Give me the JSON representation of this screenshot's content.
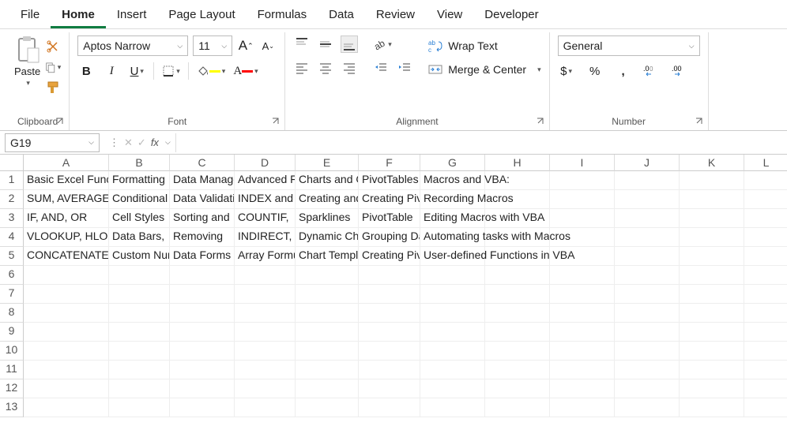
{
  "tabs": [
    "File",
    "Home",
    "Insert",
    "Page Layout",
    "Formulas",
    "Data",
    "Review",
    "View",
    "Developer"
  ],
  "active_tab": "Home",
  "ribbon": {
    "clipboard": {
      "label": "Clipboard",
      "paste": "Paste"
    },
    "font": {
      "label": "Font",
      "name": "Aptos Narrow",
      "size": "11",
      "increase": "A",
      "decrease": "A",
      "bold": "B",
      "italic": "I",
      "underline": "U"
    },
    "alignment": {
      "label": "Alignment",
      "wrap": "Wrap Text",
      "merge": "Merge & Center"
    },
    "number": {
      "label": "Number",
      "format": "General",
      "currency": "$",
      "percent": "%",
      "comma": ","
    }
  },
  "name_box": "G19",
  "formula": "",
  "columns": [
    "A",
    "B",
    "C",
    "D",
    "E",
    "F",
    "G",
    "H",
    "I",
    "J",
    "K",
    "L"
  ],
  "rows": [
    "1",
    "2",
    "3",
    "4",
    "5",
    "6",
    "7",
    "8",
    "9",
    "10",
    "11",
    "12",
    "13"
  ],
  "cells": {
    "r1": [
      "Basic Excel Functions",
      "Formatting",
      "Data Management",
      "Advanced Functions",
      "Charts and Graphs",
      "PivotTables",
      "Macros and VBA:",
      "",
      "",
      "",
      "",
      ""
    ],
    "r2": [
      "SUM, AVERAGE",
      "Conditional",
      "Data Validation",
      "INDEX and",
      "Creating and",
      "Creating Pivot",
      "Recording Macros",
      "",
      "",
      "",
      "",
      ""
    ],
    "r3": [
      "IF, AND, OR",
      "Cell Styles",
      "Sorting and",
      "COUNTIF,",
      "Sparklines",
      "PivotTable",
      "Editing Macros with VBA",
      "",
      "",
      "",
      "",
      ""
    ],
    "r4": [
      "VLOOKUP, HLOOKUP",
      "Data Bars,",
      "Removing",
      "INDIRECT,",
      "Dynamic Charts",
      "Grouping Data",
      "Automating tasks with Macros",
      "",
      "",
      "",
      "",
      ""
    ],
    "r5": [
      "CONCATENATE",
      "Custom Number",
      "Data Forms",
      "Array Formulas",
      "Chart Templates",
      "Creating Pivot",
      "User-defined Functions in VBA",
      "",
      "",
      "",
      "",
      ""
    ]
  }
}
